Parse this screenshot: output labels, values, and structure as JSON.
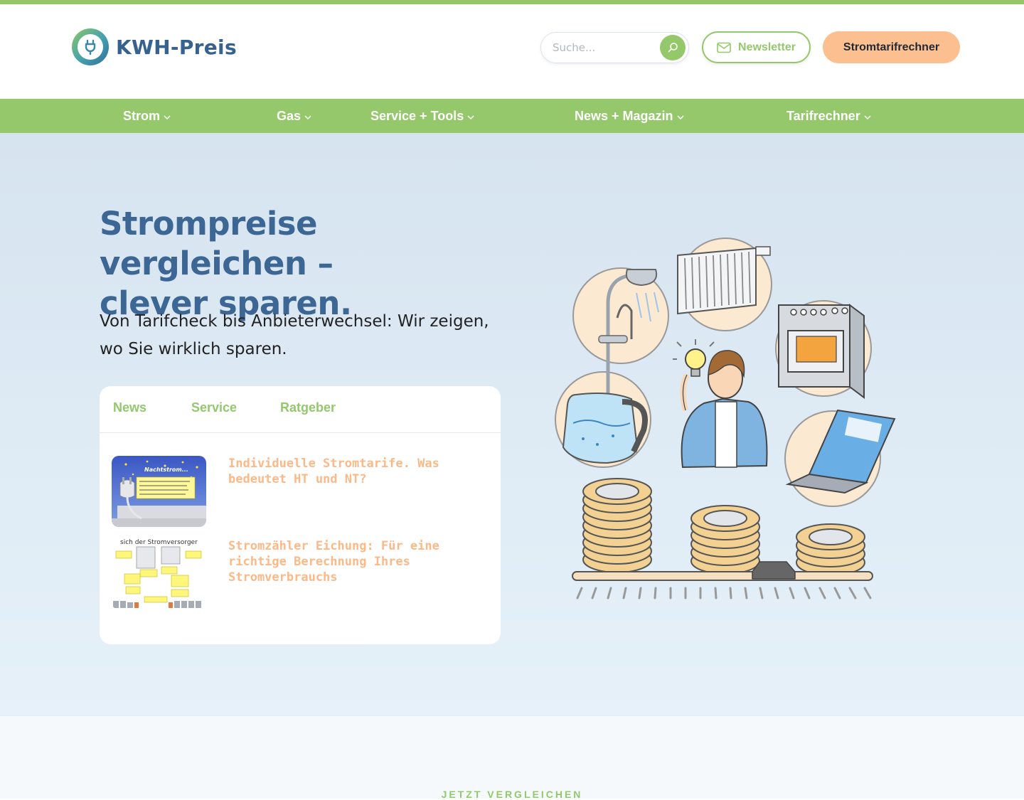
{
  "brand": {
    "name": "KWH-Preis"
  },
  "search": {
    "placeholder": "Suche..."
  },
  "header": {
    "newsletter_label": "Newsletter",
    "calc_label": "Stromtarifrechner"
  },
  "nav": {
    "items": [
      {
        "label": "Strom"
      },
      {
        "label": "Gas"
      },
      {
        "label": "Service + Tools"
      },
      {
        "label": "News + Magazin"
      },
      {
        "label": "Tarifrechner"
      }
    ]
  },
  "hero": {
    "title_line1": "Strompreise vergleichen –",
    "title_line2": "clever sparen.",
    "lead": "Von Tarifcheck bis Anbieterwechsel: Wir zeigen, wo Sie wirklich sparen."
  },
  "card": {
    "tabs": [
      {
        "label": "News"
      },
      {
        "label": "Service"
      },
      {
        "label": "Ratgeber"
      }
    ],
    "posts": [
      {
        "title": "Individuelle Stromtarife. Was bedeutet HT und NT?",
        "thumb_heading": "Nachtstrom..."
      },
      {
        "title": "Stromzähler Eichung: Für eine richtige Berechnung Ihres Stromverbrauchs",
        "thumb_heading": "sich der Stromversorger"
      }
    ]
  },
  "section_next": {
    "eyebrow": "JETZT VERGLEICHEN"
  },
  "colors": {
    "accent_green": "#94c86b",
    "brand_blue": "#3c6693",
    "peach": "#fcc090",
    "hero_bg": "#d6e4f0"
  },
  "icons": {
    "search": "search-icon",
    "newsletter": "mail-icon",
    "chevron": "chevron-down-icon"
  }
}
